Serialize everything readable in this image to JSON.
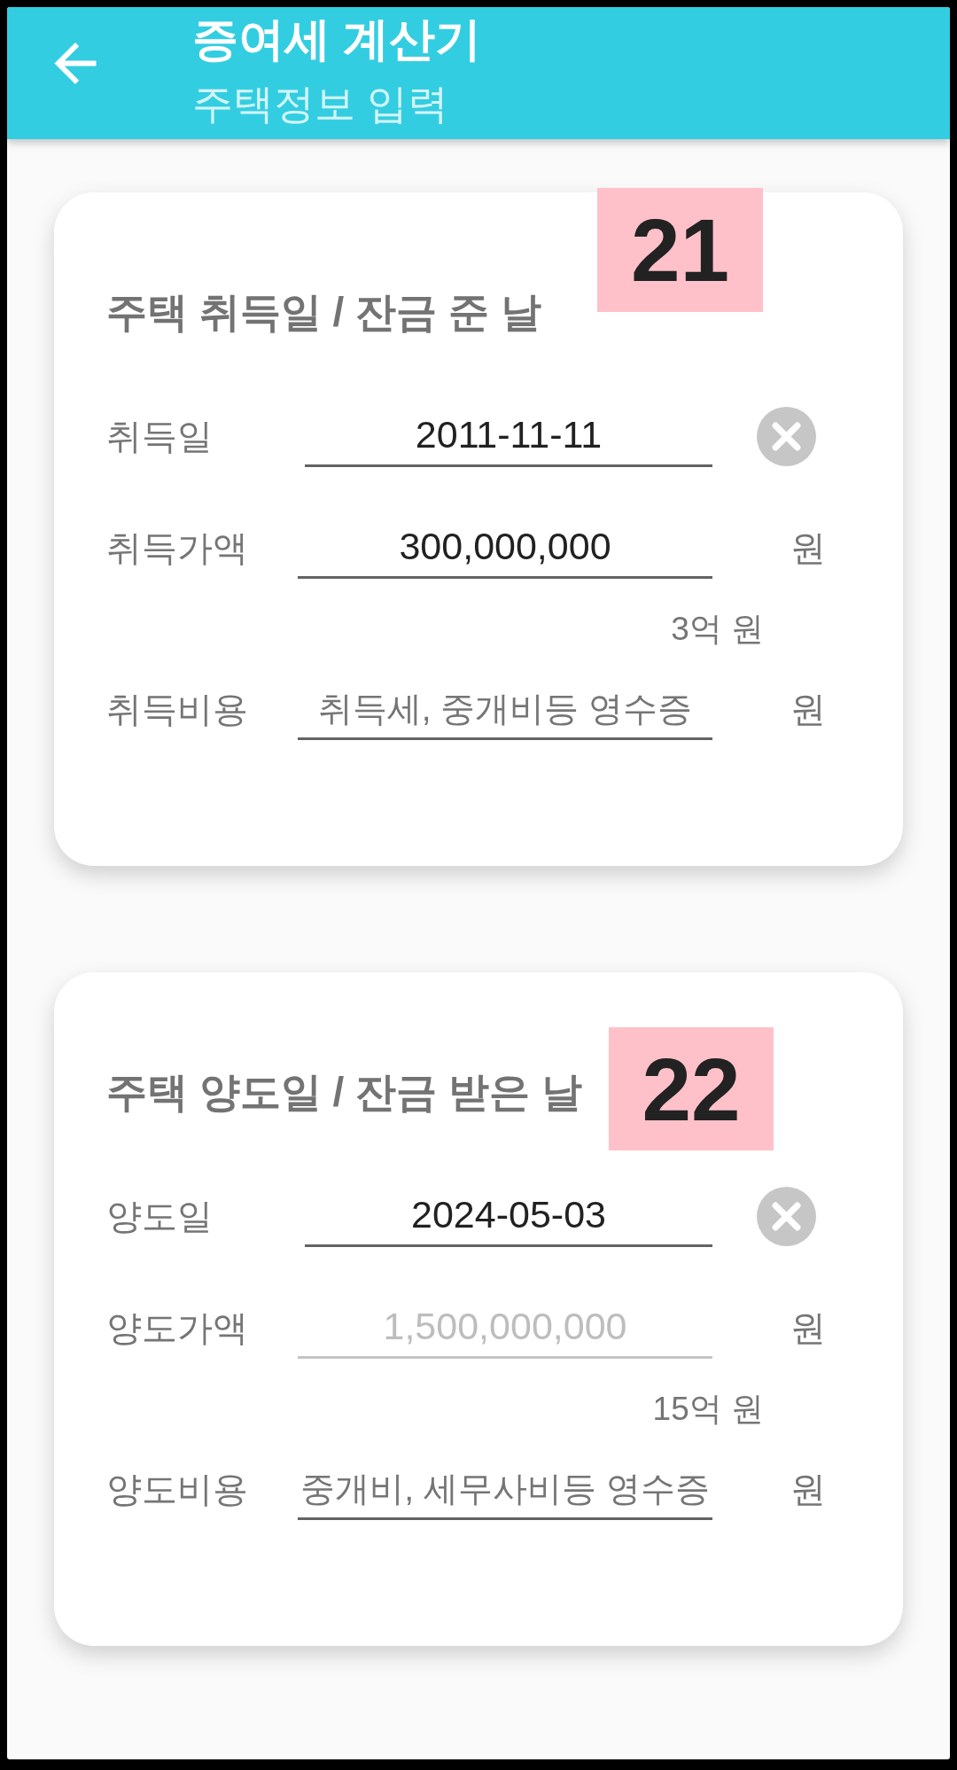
{
  "app_bar": {
    "title": "증여세 계산기",
    "subtitle": "주택정보 입력"
  },
  "cards": [
    {
      "title": "주택 취득일 / 잔금 준 날",
      "badge": "21",
      "fields": [
        {
          "kind": "date",
          "label": "취득일",
          "value": "2011-11-11",
          "disabled": false
        },
        {
          "kind": "amount",
          "label": "취득가액",
          "value": "300,000,000",
          "disabled": false,
          "unit": "원",
          "note": "3억 원"
        },
        {
          "kind": "amount",
          "label": "취득비용",
          "placeholder": "취득세, 중개비등 영수증",
          "disabled": false,
          "unit": "원"
        }
      ]
    },
    {
      "title": "주택 양도일 / 잔금 받은 날",
      "badge": "22",
      "fields": [
        {
          "kind": "date",
          "label": "양도일",
          "value": "2024-05-03",
          "disabled": false
        },
        {
          "kind": "amount",
          "label": "양도가액",
          "value": "1,500,000,000",
          "disabled": true,
          "unit": "원",
          "note": "15억 원"
        },
        {
          "kind": "amount",
          "label": "양도비용",
          "placeholder": "중개비, 세무사비등 영수증",
          "disabled": false,
          "unit": "원"
        }
      ]
    }
  ]
}
